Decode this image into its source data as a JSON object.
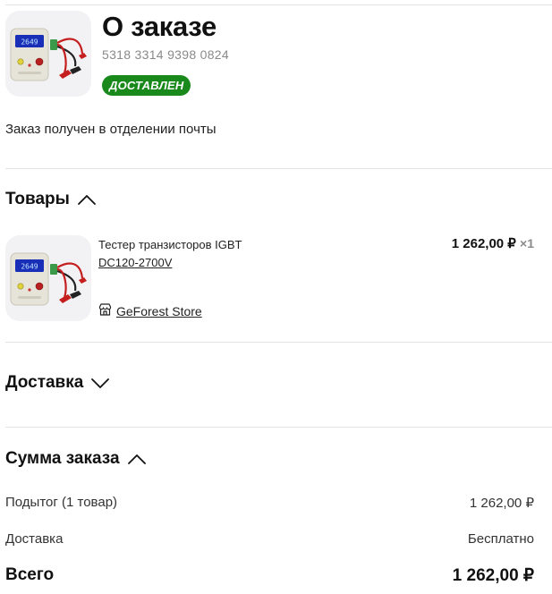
{
  "order": {
    "title": "О заказе",
    "number": "5318 3314 9398 0824",
    "status_badge": "ДОСТАВЛЕН",
    "status_text": "Заказ получен в отделении почты"
  },
  "products": {
    "title": "Товары",
    "expanded": true,
    "items": [
      {
        "name": "Тестер транзисторов IGBT",
        "sku": "DC120-2700V",
        "price": "1 262,00 ₽",
        "qty": "×1",
        "store": "GeForest Store",
        "device_display": "2649"
      }
    ]
  },
  "delivery": {
    "title": "Доставка",
    "expanded": false
  },
  "summary": {
    "title": "Сумма заказа",
    "expanded": true,
    "subtotal_label": "Подытог (1 товар)",
    "subtotal_value": "1 262,00 ₽",
    "delivery_label": "Доставка",
    "delivery_value": "Бесплатно",
    "total_label": "Всего",
    "total_value": "1 262,00 ₽"
  },
  "colors": {
    "status_badge_bg": "#19891c",
    "divider": "#e3e3e3",
    "thumb_bg": "#f2f2f4"
  }
}
